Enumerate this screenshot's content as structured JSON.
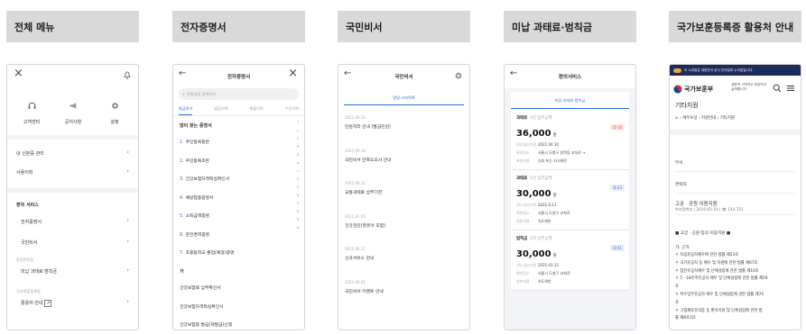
{
  "headers": [
    "전체 메뉴",
    "전자증명서",
    "국민비서",
    "미납 과태료·범칙금",
    "국가보훈등록증 활용처 안내"
  ],
  "menu": {
    "close": "×",
    "quick": [
      "고객센터",
      "공지사항",
      "설정"
    ],
    "items": [
      "내 신분증 관리",
      "사용이력"
    ],
    "section_title": "편의 서비스",
    "sub_items": [
      "전자증명서",
      "국민비서"
    ],
    "group1_label": "운전면허증",
    "group1_item": "미납 과태료·범칙금",
    "group2_label": "국가보훈등록증",
    "group2_item": "활용처 안내"
  },
  "cert": {
    "back": "←",
    "title": "전자증명서",
    "close": "×",
    "search_placeholder": "민원서류 검색하기",
    "tabs": [
      "발급하기",
      "발급이력",
      "제출이력",
      "수신이력"
    ],
    "section": "많이 찾는 증명서",
    "list": [
      {
        "num": "1.",
        "label": "주민등록등본"
      },
      {
        "num": "2.",
        "label": "주민등록초본"
      },
      {
        "num": "3.",
        "label": "건강보험자격득실확인서"
      },
      {
        "num": "4.",
        "label": "예방접종증명서"
      },
      {
        "num": "5.",
        "label": "소득금액증명"
      },
      {
        "num": "6.",
        "label": "운전경력증명"
      },
      {
        "num": "7.",
        "label": "초중등학교 졸업(예정)증명"
      }
    ],
    "section2": "가",
    "list2": [
      "건강보험료 납부확인서",
      "건강보험자격득실확인서",
      "건강보험증 발급(재발급)신청"
    ],
    "index": [
      "ㄱ",
      "ㄴ",
      "ㄷ",
      "ㄹ",
      "ㅁ",
      "ㅂ",
      "ㅅ",
      "ㅇ",
      "ㅈ",
      "ㅊ",
      "ㅋ",
      "ㅌ",
      "ㅍ",
      "ㅎ"
    ]
  },
  "secretary": {
    "back": "←",
    "title": "국민비서",
    "tab": "알림·고지목록",
    "items": [
      {
        "date": "2021.09.10",
        "text": "민원처리 안내 (발급민원)"
      },
      {
        "date": "2021.09.10",
        "text": "국민비서 만족도조사 안내"
      },
      {
        "date": "2021.08.11",
        "text": "교통과태료 납부기한"
      },
      {
        "date": "2021.07.05",
        "text": "건강검진(영유아 포함)"
      },
      {
        "date": "2021.06.21",
        "text": "신규서비스 안내"
      },
      {
        "date": "2021.06.01",
        "text": "국민비서 이벤트 안내"
      }
    ]
  },
  "fines": {
    "back": "←",
    "title": "편의서비스",
    "tab": "미납 과태료·범칙금",
    "cards": [
      {
        "type": "과태료",
        "count": "2건 납부금액",
        "amount": "36,000",
        "unit": "원",
        "badge": "D-10",
        "badge_color": "#e0403a",
        "badge_bg": "#fde8e7",
        "rows": [
          [
            "1차 납부기한",
            "2021.04.10"
          ],
          [
            "위반장소",
            "서울시 도봉구 방학동 교차로 →"
          ],
          [
            "위반내용",
            "신호 또는 지시위반"
          ]
        ]
      },
      {
        "type": "과태료",
        "count": "1건 납부금액",
        "amount": "30,000",
        "unit": "원",
        "badge": "D-23",
        "badge_color": "#3a6bd0",
        "badge_bg": "#e6eefb",
        "rows": [
          [
            "1차 납부기한",
            "2021.6.11"
          ],
          [
            "위반장소",
            "서울시 도봉구 교차로"
          ],
          [
            "위반내용",
            "속도위반"
          ]
        ]
      },
      {
        "type": "범칙금",
        "count": "1건 납부금액",
        "amount": "30,000",
        "unit": "원",
        "badge": "D-41",
        "badge_color": "#3a6bd0",
        "badge_bg": "#e6eefb",
        "rows": [
          [
            "1차 납부기한",
            "2021.03.12"
          ],
          [
            "위반장소",
            "서울시 도봉구 교차로"
          ],
          [
            "위반내용",
            "속도위반"
          ]
        ]
      }
    ]
  },
  "veteran": {
    "banner": "이 누리집은 대한민국 공식 전자정부 누리집입니다.",
    "logo_text": "국가보훈부",
    "slogan": "영원히 기억하고 보답하고 싶어합니다",
    "page_title": "기타지원",
    "breadcrumb": "› 예우보상 › 지원안내 › 기타지원",
    "dept_label": "부서",
    "contact_label": "연락처",
    "article_title": "고궁 · 공원 이용지원",
    "article_meta": "복지정책과 | 2010-03-10 | 👁 144,721",
    "section_head": "■ 고궁 · 공원 등의 이용지원 ■",
    "basis_head": "가. 근거",
    "basis": [
      "ㅇ 독립유공자예우에 관한 법률 제23조",
      "ㅇ 국가유공자 등 예우 및 지원에 관한 법률 제67조",
      "ㅇ 참전유공자예우 및 단체설립에 관한 법률 제10조",
      "ㅇ 5 · 18민주유공자 예우 및 단체설립에 관한 법률 제59",
      "조 ",
      "ㅇ 특수임무유공자 예우 및 단체설립에 관한 법률 제74",
      "조",
      "ㅇ 고엽제후유의증 등 환자지원 및 단체설립에 관한 법",
      "률 제8조의3"
    ]
  }
}
